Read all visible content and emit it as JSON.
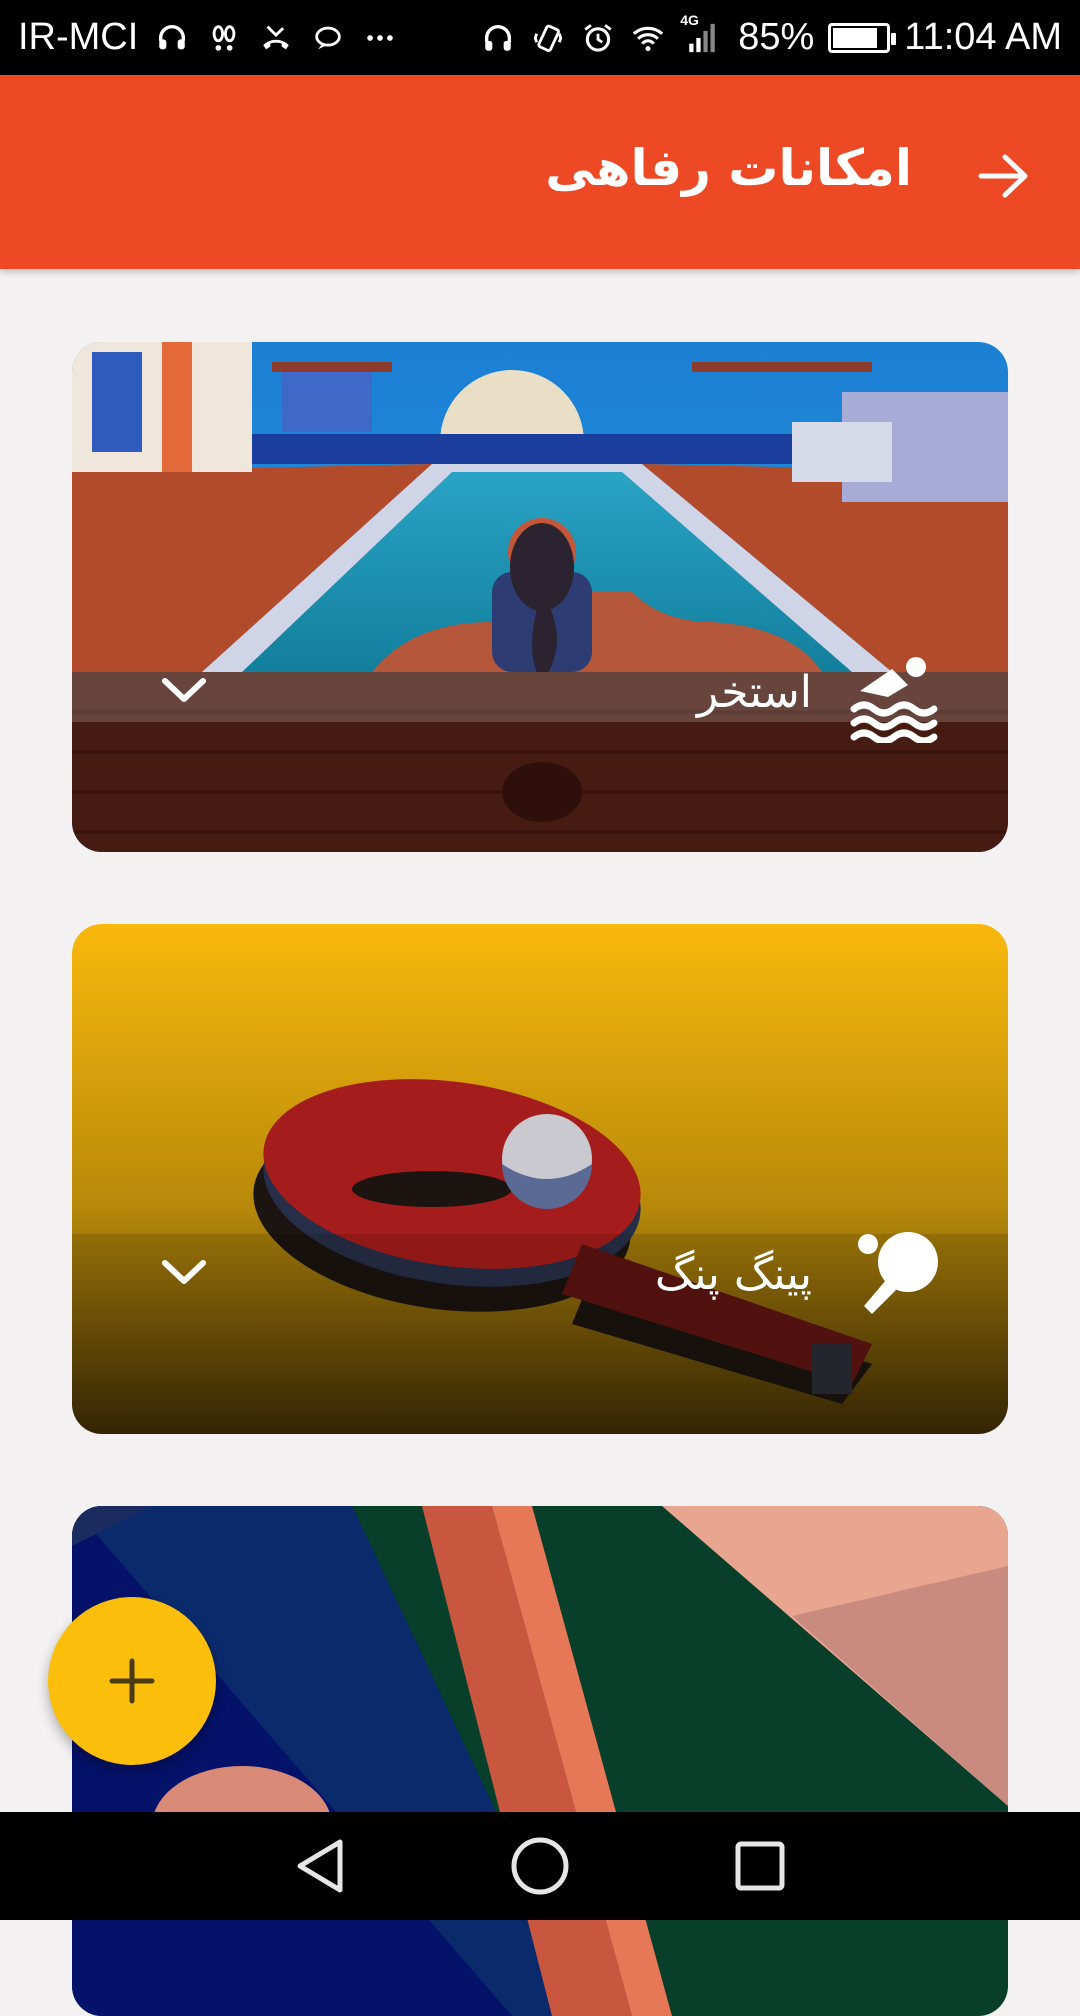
{
  "status_bar": {
    "carrier": "IR-MCI",
    "network": "4G",
    "battery": "85%",
    "battery_level": 0.85,
    "time": "11:04 AM"
  },
  "app_bar": {
    "title": "امکانات رفاهی",
    "back_icon": "arrow-right-icon"
  },
  "cards": [
    {
      "label": "استخر",
      "icon": "swimming-icon",
      "art": "pool-illustration"
    },
    {
      "label": "پینگ پنگ",
      "icon": "ping-pong-icon",
      "art": "ping-pong-illustration"
    },
    {
      "label": "",
      "icon": "",
      "art": "table-tennis-illustration"
    }
  ],
  "fab": {
    "icon": "plus-icon"
  },
  "nav_bar": {
    "back": "back-icon",
    "home": "home-icon",
    "recents": "recents-icon"
  },
  "colors": {
    "app_bar": "#ec4924",
    "fab": "#fbbe0b",
    "background": "#f3f1f1"
  }
}
